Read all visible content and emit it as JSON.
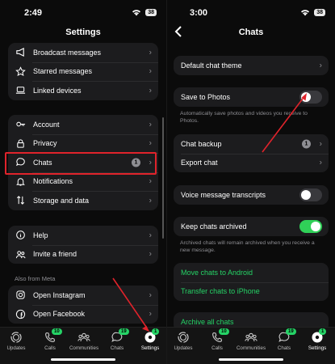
{
  "left": {
    "time": "2:49",
    "battery": "38",
    "title": "Settings",
    "group1": [
      "Broadcast messages",
      "Starred messages",
      "Linked devices"
    ],
    "group2": [
      "Account",
      "Privacy",
      "Chats",
      "Notifications",
      "Storage and data"
    ],
    "chats_badge": "1",
    "group3": [
      "Help",
      "Invite a friend"
    ],
    "meta_section": "Also from Meta",
    "group4": [
      "Open Instagram",
      "Open Facebook"
    ]
  },
  "right": {
    "time": "3:00",
    "battery": "38",
    "title": "Chats",
    "default_theme": "Default chat theme",
    "save_photos": "Save to Photos",
    "save_photos_on": false,
    "save_caption": "Automatically save photos and videos you receive to Photos.",
    "chat_backup": "Chat backup",
    "backup_badge": "1",
    "export_chat": "Export chat",
    "voice_transcripts": "Voice message transcripts",
    "voice_on": false,
    "keep_archived": "Keep chats archived",
    "keep_archived_on": true,
    "archived_caption": "Archived chats will remain archived when you receive a new message.",
    "move_android": "Move chats to Android",
    "transfer_iphone": "Transfer chats to iPhone",
    "archive_all": "Archive all chats"
  },
  "tabs": [
    {
      "label": "Updates",
      "badge": ""
    },
    {
      "label": "Calls",
      "badge": "10"
    },
    {
      "label": "Communities",
      "badge": ""
    },
    {
      "label": "Chats",
      "badge": "19"
    },
    {
      "label": "Settings",
      "badge": "1"
    }
  ],
  "colors": {
    "accent_green": "#25d366",
    "highlight_red": "#e0232b"
  }
}
